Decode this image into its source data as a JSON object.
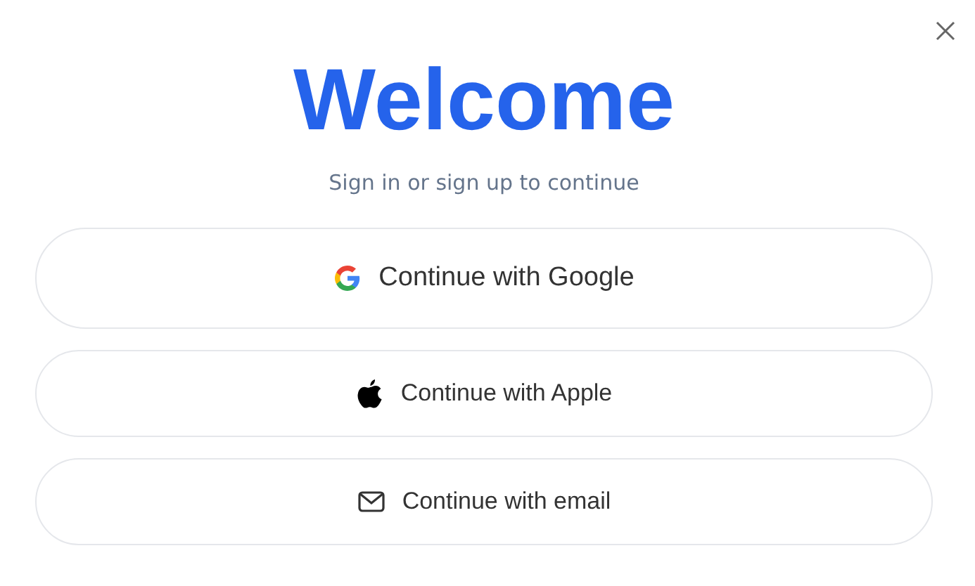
{
  "title": "Welcome",
  "subtitle": "Sign in or sign up to continue",
  "buttons": [
    {
      "kind": "google",
      "label": "Continue with Google"
    },
    {
      "kind": "apple",
      "label": "Continue with Apple"
    },
    {
      "kind": "email",
      "label": "Continue with email"
    }
  ]
}
